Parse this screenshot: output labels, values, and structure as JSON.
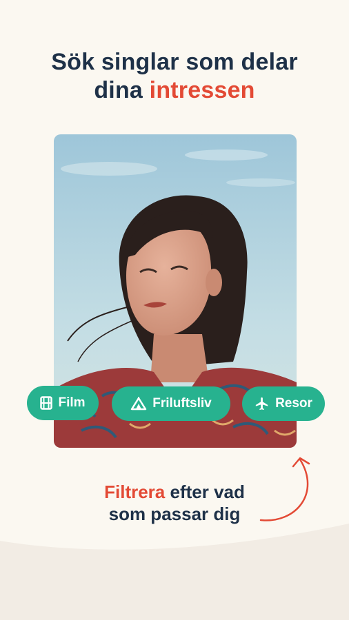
{
  "headline": {
    "line1": "Sök singlar som delar",
    "line2_prefix": "dina ",
    "line2_accent": "intressen"
  },
  "chips": [
    {
      "label": "Film",
      "icon": "film-icon"
    },
    {
      "label": "Friluftsliv",
      "icon": "tent-icon"
    },
    {
      "label": "Resor",
      "icon": "airplane-icon"
    }
  ],
  "caption": {
    "accent": "Filtrera",
    "line1_rest": " efter vad",
    "line2": "som passar dig"
  },
  "colors": {
    "background": "#fbf8f1",
    "headline": "#1e3148",
    "accent": "#e34a35",
    "chip": "#27b28f"
  }
}
